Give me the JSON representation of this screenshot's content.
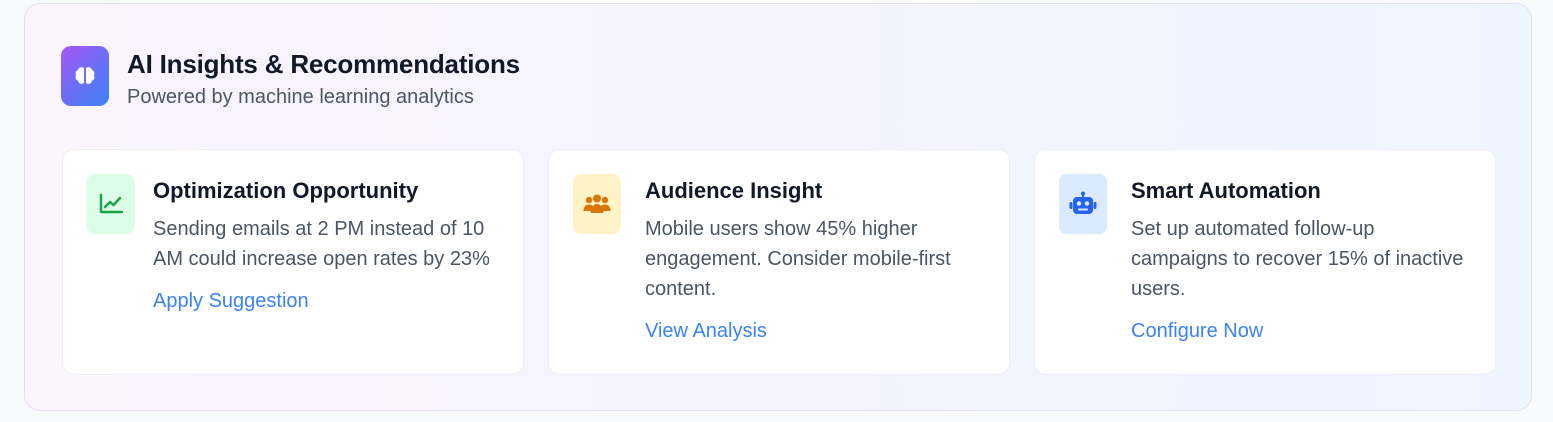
{
  "header": {
    "title": "AI Insights & Recommendations",
    "subtitle": "Powered by machine learning analytics",
    "icon": "brain-icon",
    "icon_gradient": [
      "#a855f7",
      "#3b82f6"
    ]
  },
  "cards": [
    {
      "icon": "line-chart-icon",
      "icon_bg": "#dcfce7",
      "icon_color": "#16a34a",
      "title": "Optimization Opportunity",
      "description": "Sending emails at 2 PM instead of 10 AM could increase open rates by 23%",
      "link": "Apply Suggestion"
    },
    {
      "icon": "users-icon",
      "icon_bg": "#fef3c7",
      "icon_color": "#d97706",
      "title": "Audience Insight",
      "description": "Mobile users show 45% higher engagement. Consider mobile-first content.",
      "link": "View Analysis"
    },
    {
      "icon": "robot-icon",
      "icon_bg": "#dbeafe",
      "icon_color": "#2563eb",
      "title": "Smart Automation",
      "description": "Set up automated follow-up campaigns to recover 15% of inactive users.",
      "link": "Configure Now"
    }
  ],
  "colors": {
    "link": "#3b82f6",
    "title": "#111827",
    "text": "#4b5563"
  }
}
